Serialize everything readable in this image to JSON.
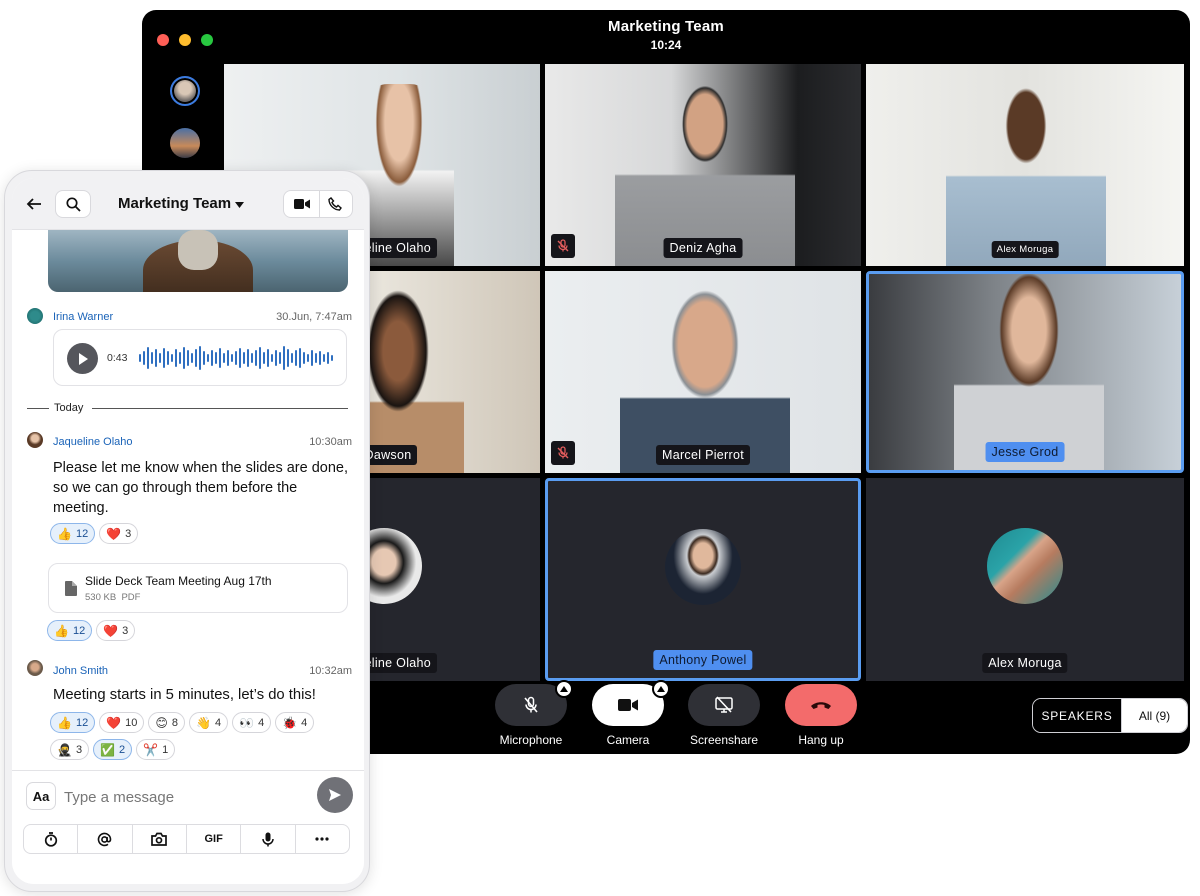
{
  "call": {
    "title": "Marketing Team",
    "time": "10:24",
    "participants": [
      {
        "name": "queline Olaho",
        "muted": false,
        "active": false
      },
      {
        "name": "Deniz Agha",
        "muted": true,
        "active": false
      },
      {
        "name": "Alex Moruga",
        "muted": false,
        "active": false
      },
      {
        "name": "m Dawson",
        "muted": false,
        "active": false
      },
      {
        "name": "Marcel Pierrot",
        "muted": true,
        "active": false
      },
      {
        "name": "Jesse Grod",
        "muted": false,
        "active": true
      },
      {
        "name": "queline Olaho",
        "muted": false,
        "active": false
      },
      {
        "name": "Anthony Powel",
        "muted": false,
        "active": true
      },
      {
        "name": "Alex Moruga",
        "muted": false,
        "active": false
      }
    ],
    "controls": {
      "microphone": "Microphone",
      "camera": "Camera",
      "screenshare": "Screenshare",
      "hangup": "Hang up"
    },
    "view_toggle": {
      "speakers": "SPEAKERS",
      "all": "All (9)"
    },
    "colors": {
      "active_border": "#5a9cf0",
      "hangup": "#f36b6b"
    }
  },
  "phone": {
    "header": {
      "title": "Marketing Team"
    },
    "messages": {
      "irina": {
        "sender": "Irina Warner",
        "time": "30.Jun, 7:47am",
        "audio_duration": "0:43"
      },
      "divider": "Today",
      "jaqueline": {
        "sender": "Jaqueline Olaho",
        "time": "10:30am",
        "text": "Please let me know when the slides are done, so we can go through them before the meeting.",
        "reactions": [
          {
            "emoji": "👍",
            "count": "12"
          },
          {
            "emoji": "❤️",
            "count": "3"
          }
        ],
        "file": {
          "name": "Slide Deck Team Meeting Aug 17th",
          "meta": "530 KB  PDF"
        },
        "file_reactions": [
          {
            "emoji": "👍",
            "count": "12"
          },
          {
            "emoji": "❤️",
            "count": "3"
          }
        ]
      },
      "john": {
        "sender": "John Smith",
        "time": "10:32am",
        "text": "Meeting starts in 5 minutes, let’s do this!",
        "reactions": [
          {
            "emoji": "👍",
            "count": "12"
          },
          {
            "emoji": "❤️",
            "count": "10"
          },
          {
            "emoji": "😊",
            "count": "8"
          },
          {
            "emoji": "👋",
            "count": "4"
          },
          {
            "emoji": "👀",
            "count": "4"
          },
          {
            "emoji": "🐞",
            "count": "4"
          },
          {
            "emoji": "🥷",
            "count": "3"
          },
          {
            "emoji": "✅",
            "count": "2"
          },
          {
            "emoji": "✂️",
            "count": "1"
          }
        ]
      }
    },
    "composer": {
      "font_button": "Aa",
      "placeholder": "Type a message",
      "gif": "GIF"
    }
  }
}
